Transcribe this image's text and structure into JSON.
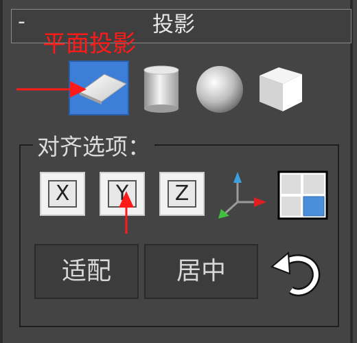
{
  "panel": {
    "collapse_label": "-",
    "title": "投影"
  },
  "annotation": {
    "label": "平面投影",
    "color": "#ff1a1a"
  },
  "projection_icons": [
    "plane-icon",
    "cylinder-icon",
    "sphere-icon",
    "box-icon"
  ],
  "align_group": {
    "label": "对齐选项：",
    "axes": [
      "X",
      "Y",
      "Z"
    ],
    "fit_label": "适配",
    "center_label": "居中"
  },
  "colors": {
    "background": "#444444",
    "selected": "#3d7fd8",
    "axis_x": "#e02020",
    "axis_y": "#40c040",
    "axis_z": "#3aa0e0"
  }
}
